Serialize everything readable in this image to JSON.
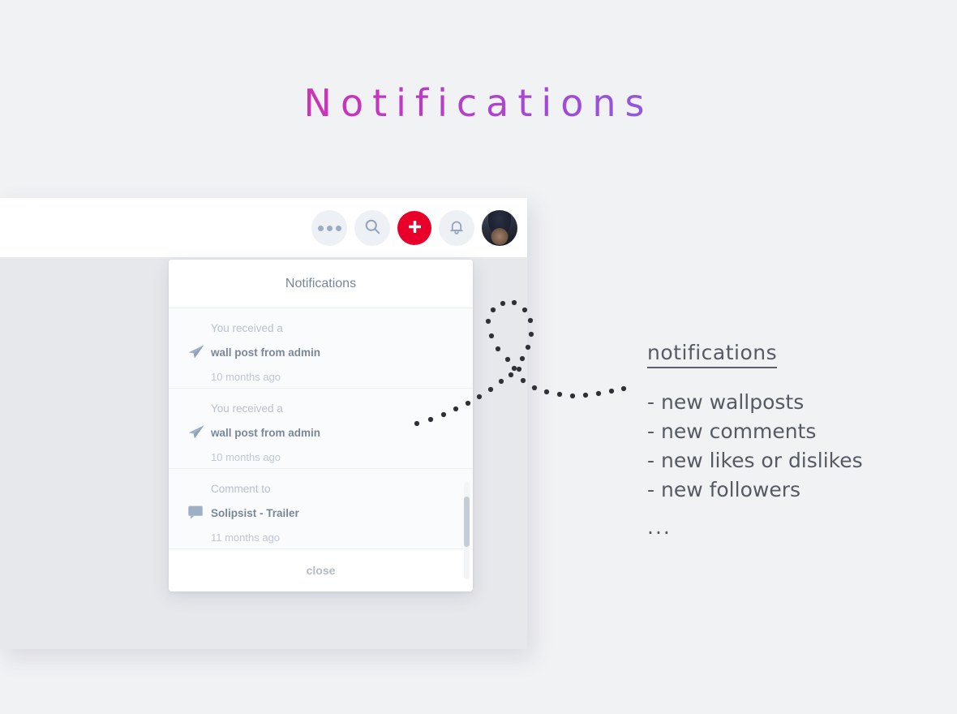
{
  "page": {
    "title": "Notifications",
    "background_color": "#f1f2f4",
    "title_gradient_from": "#e5357f",
    "title_gradient_to": "#6b86df"
  },
  "toolbar": {
    "more_icon": "ellipsis-icon",
    "search_icon": "search-icon",
    "add_label": "+",
    "add_icon": "plus-icon",
    "add_color": "#e8002b",
    "bell_icon": "bell-icon",
    "avatar_icon": "avatar"
  },
  "notifications_panel": {
    "header": "Notifications",
    "close_label": "close",
    "items": [
      {
        "icon": "paper-plane-icon",
        "prefix": "You received a",
        "subject": "wall post from admin",
        "time": "10 months ago"
      },
      {
        "icon": "paper-plane-icon",
        "prefix": "You received a",
        "subject": "wall post from admin",
        "time": "10 months ago"
      },
      {
        "icon": "comment-bubble-icon",
        "prefix": "Comment to",
        "subject": "Solipsist - Trailer",
        "time": "11 months ago"
      }
    ]
  },
  "annotation": {
    "title": "notifications",
    "items": [
      "- new wallposts",
      "- new comments",
      "- new likes or dislikes",
      "- new followers"
    ],
    "more": "..."
  }
}
